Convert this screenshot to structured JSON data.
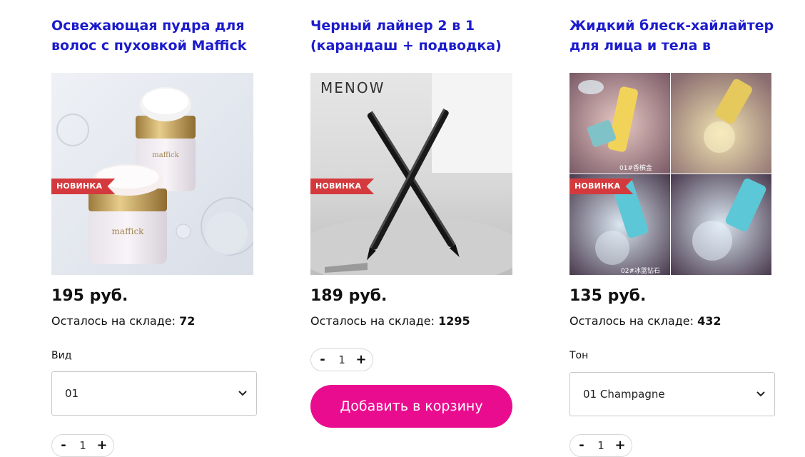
{
  "products": [
    {
      "title": "Освежающая пудра для волос с пуховкой Maffick",
      "badge": "НОВИНКА",
      "price": "195 руб.",
      "stock_label": "Осталось на складе:",
      "stock_value": "72",
      "option_label": "Вид",
      "option_selected": "01",
      "quantity": "1",
      "minus": "-",
      "plus": "+",
      "image_brand": "maffick"
    },
    {
      "title": "Черный лайнер 2 в 1 (карандаш + подводка)",
      "badge": "НОВИНКА",
      "price": "189 руб.",
      "stock_label": "Осталось на складе:",
      "stock_value": "1295",
      "quantity": "1",
      "minus": "-",
      "plus": "+",
      "add_to_cart": "Добавить в корзину",
      "image_brand": "MENOW"
    },
    {
      "title": "Жидкий блеск-хайлайтер для лица и тела в",
      "badge": "НОВИНКА",
      "price": "135 руб.",
      "stock_label": "Осталось на складе:",
      "stock_value": "432",
      "option_label": "Тон",
      "option_selected": "01 Champagne",
      "quantity": "1",
      "minus": "-",
      "plus": "+",
      "image_caption_1": "01#香槟金",
      "image_caption_2": "02#冰蓝钻石"
    }
  ],
  "colors": {
    "title": "#1c1ccc",
    "badge": "#d43a3d",
    "cart_button": "#ea0c8f"
  }
}
